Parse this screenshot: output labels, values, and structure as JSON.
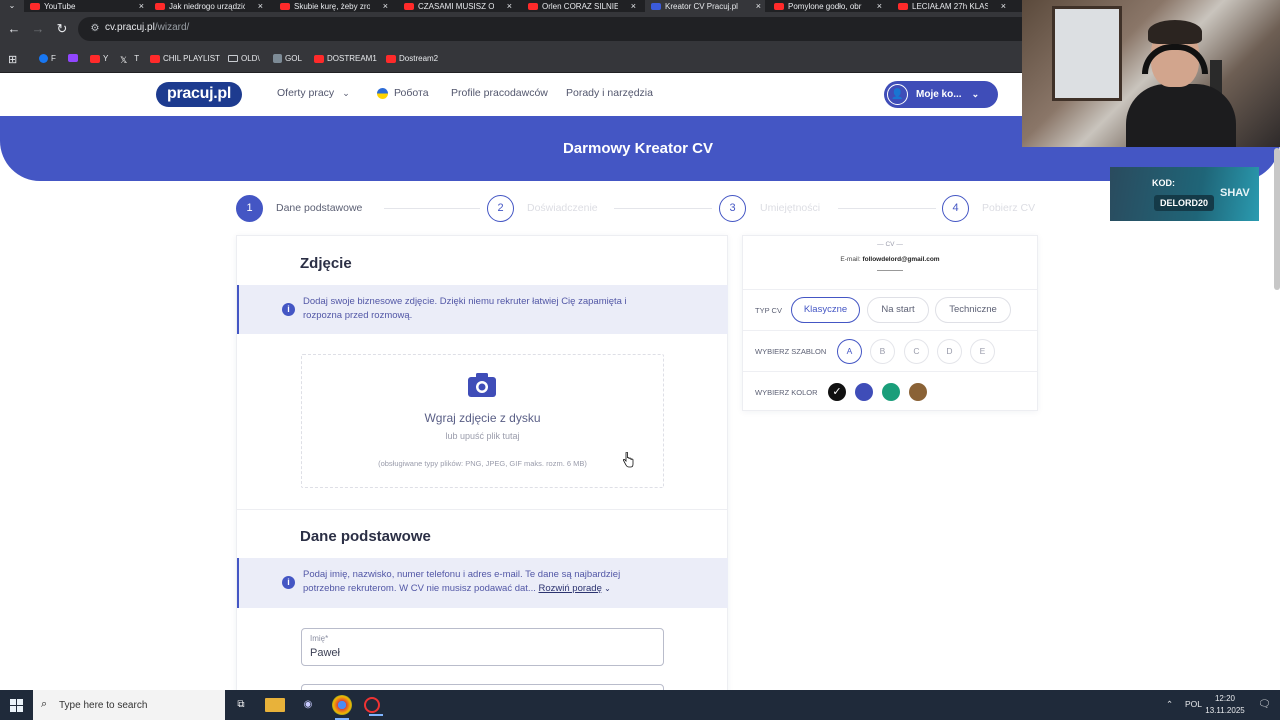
{
  "browser": {
    "tabs": [
      {
        "title": "YouTube",
        "favicon": "youtube-icon"
      },
      {
        "title": "Jak niedrogo urządzić",
        "favicon": "youtube-icon"
      },
      {
        "title": "Skubie kurę, żeby zro",
        "favicon": "youtube-icon"
      },
      {
        "title": "CZASAMI MUSISZ OD",
        "favicon": "youtube-icon"
      },
      {
        "title": "Orlen CORAZ SILNIEJ",
        "favicon": "youtube-icon"
      },
      {
        "title": "Kreator CV Pracuj.pl",
        "favicon": "pracuj-icon"
      },
      {
        "title": "Pomylone godło, obr",
        "favicon": "youtube-icon"
      },
      {
        "title": "LECIAŁAM 27h KLAS",
        "favicon": "youtube-icon"
      }
    ],
    "url_host": "cv.pracuj.pl",
    "url_path": "/wizard/",
    "bookmarks": [
      "F",
      "Y",
      "T",
      "CHIL PLAYLIST",
      "OLD\\",
      "GOL",
      "DOSTREAM1",
      "Dostream2"
    ]
  },
  "site": {
    "logo": "pracuj.pl",
    "nav": [
      "Oferty pracy",
      "Робота",
      "Profile pracodawców",
      "Porady i narzędzia"
    ],
    "account_label": "Moje ko...",
    "hero_title": "Darmowy Kreator CV"
  },
  "stepper": {
    "steps": [
      {
        "num": "1",
        "label": "Dane podstawowe"
      },
      {
        "num": "2",
        "label": "Doświadczenie"
      },
      {
        "num": "3",
        "label": "Umiejętności"
      },
      {
        "num": "4",
        "label": "Pobierz CV"
      }
    ]
  },
  "photo_section": {
    "title": "Zdjęcie",
    "info": "Dodaj swoje biznesowe zdjęcie. Dzięki niemu rekruter łatwiej Cię zapamięta i rozpozna przed rozmową.",
    "upload_title": "Wgraj zdjęcie z dysku",
    "upload_sub": "lub upuść plik tutaj",
    "upload_note": "(obsługiwane typy plików: PNG, JPEG, GIF maks. rozm. 6 MB)"
  },
  "basic_section": {
    "title": "Dane podstawowe",
    "info": "Podaj imię, nazwisko, numer telefonu i adres e-mail. Te dane są najbardziej potrzebne rekruterom. W CV nie musisz podawać dat...",
    "expand": "Rozwiń poradę",
    "first_name_label": "Imię*",
    "first_name_value": "Paweł"
  },
  "preview": {
    "cv_tag": "— CV —",
    "email_label": "E-mail:",
    "email_value": "followdelord@gmail.com",
    "type_label": "TYP CV",
    "types": [
      "Klasyczne",
      "Na start",
      "Techniczne"
    ],
    "selected_type": "Klasyczne",
    "template_label": "WYBIERZ SZABLON",
    "templates": [
      "A",
      "B",
      "C",
      "D",
      "E"
    ],
    "selected_template": "A",
    "color_label": "WYBIERZ KOLOR",
    "colors": [
      "#111111",
      "#3f4db8",
      "#1a9e7a",
      "#8a6236"
    ],
    "selected_color": "#111111",
    "check_mark": "✓"
  },
  "overlay": {
    "promo_kod": "KOD:",
    "promo_code": "DELORD20",
    "promo_brand": "SHAV"
  },
  "taskbar": {
    "search_placeholder": "Type here to search",
    "lang": "POL",
    "time": "12:20",
    "date": "13.11.2025"
  }
}
